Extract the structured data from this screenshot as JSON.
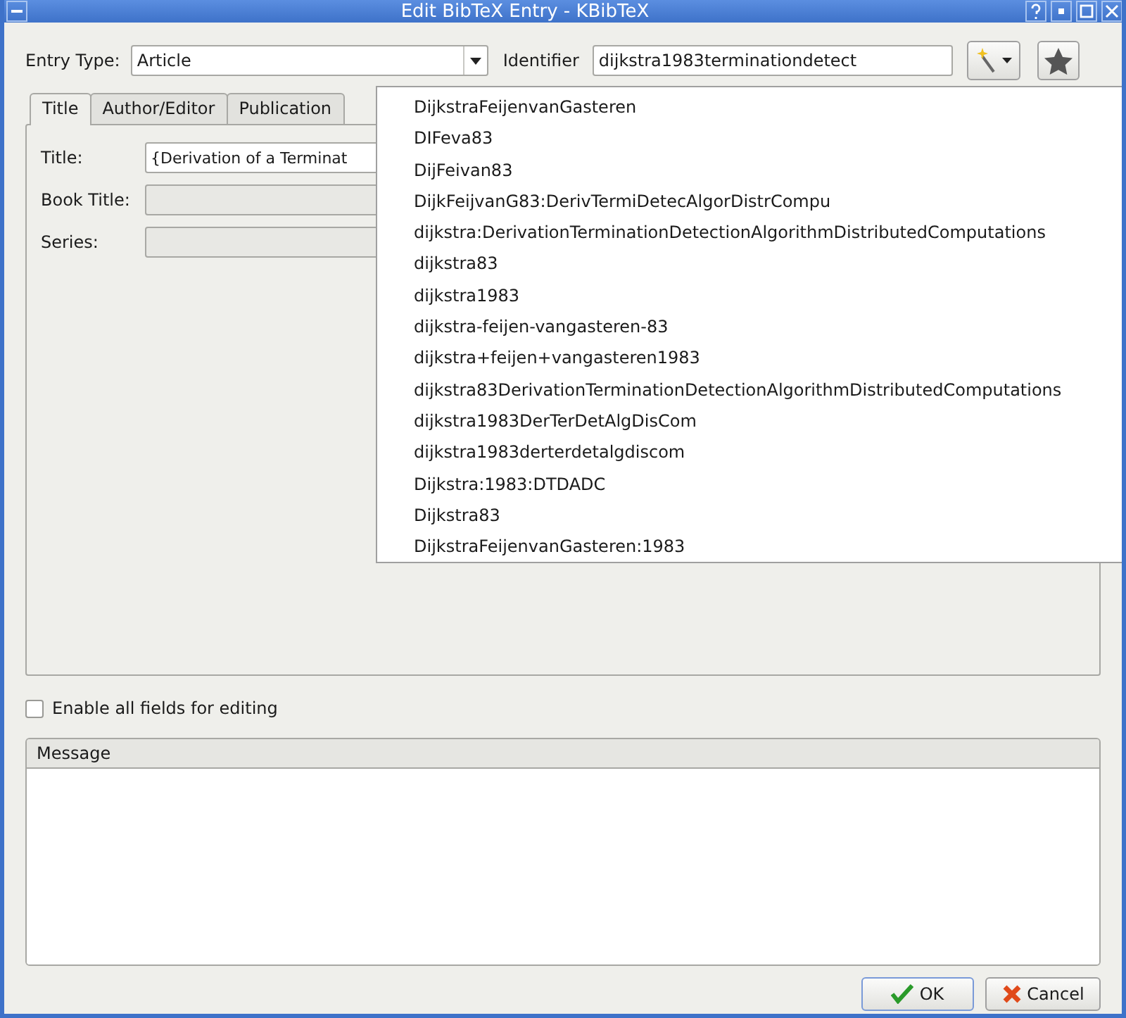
{
  "window": {
    "title": "Edit BibTeX Entry - KBibTeX"
  },
  "entry_type": {
    "label": "Entry Type:",
    "value": "Article"
  },
  "identifier": {
    "label": "Identifier",
    "value": "dijkstra1983terminationdetect"
  },
  "tabs": [
    {
      "label": "Title",
      "selected": true
    },
    {
      "label": "Author/Editor",
      "selected": false
    },
    {
      "label": "Publication",
      "selected": false
    }
  ],
  "fields": [
    {
      "label": "Title:",
      "value": "{Derivation of a Terminat"
    },
    {
      "label": "Book Title:"
    },
    {
      "label": "Series:"
    }
  ],
  "id_suggestions": [
    "DijkstraFeijenvanGasteren",
    "DIFeva83",
    "DijFeivan83",
    "DijkFeijvanG83:DerivTermiDetecAlgorDistrCompu",
    "dijkstra:DerivationTerminationDetectionAlgorithmDistributedComputations",
    "dijkstra83",
    "dijkstra1983",
    "dijkstra-feijen-vangasteren-83",
    "dijkstra+feijen+vangasteren1983",
    "dijkstra83DerivationTerminationDetectionAlgorithmDistributedComputations",
    "dijkstra1983DerTerDetAlgDisCom",
    "dijkstra1983derterdetalgdiscom",
    "Dijkstra:1983:DTDADC",
    "Dijkstra83",
    "DijkstraFeijenvanGasteren:1983"
  ],
  "enable_all": {
    "label": "Enable all fields for editing",
    "checked": false
  },
  "message": {
    "title": "Message"
  },
  "buttons": [
    {
      "label": "OK",
      "kind": "ok"
    },
    {
      "label": "Cancel",
      "kind": "cancel"
    }
  ]
}
